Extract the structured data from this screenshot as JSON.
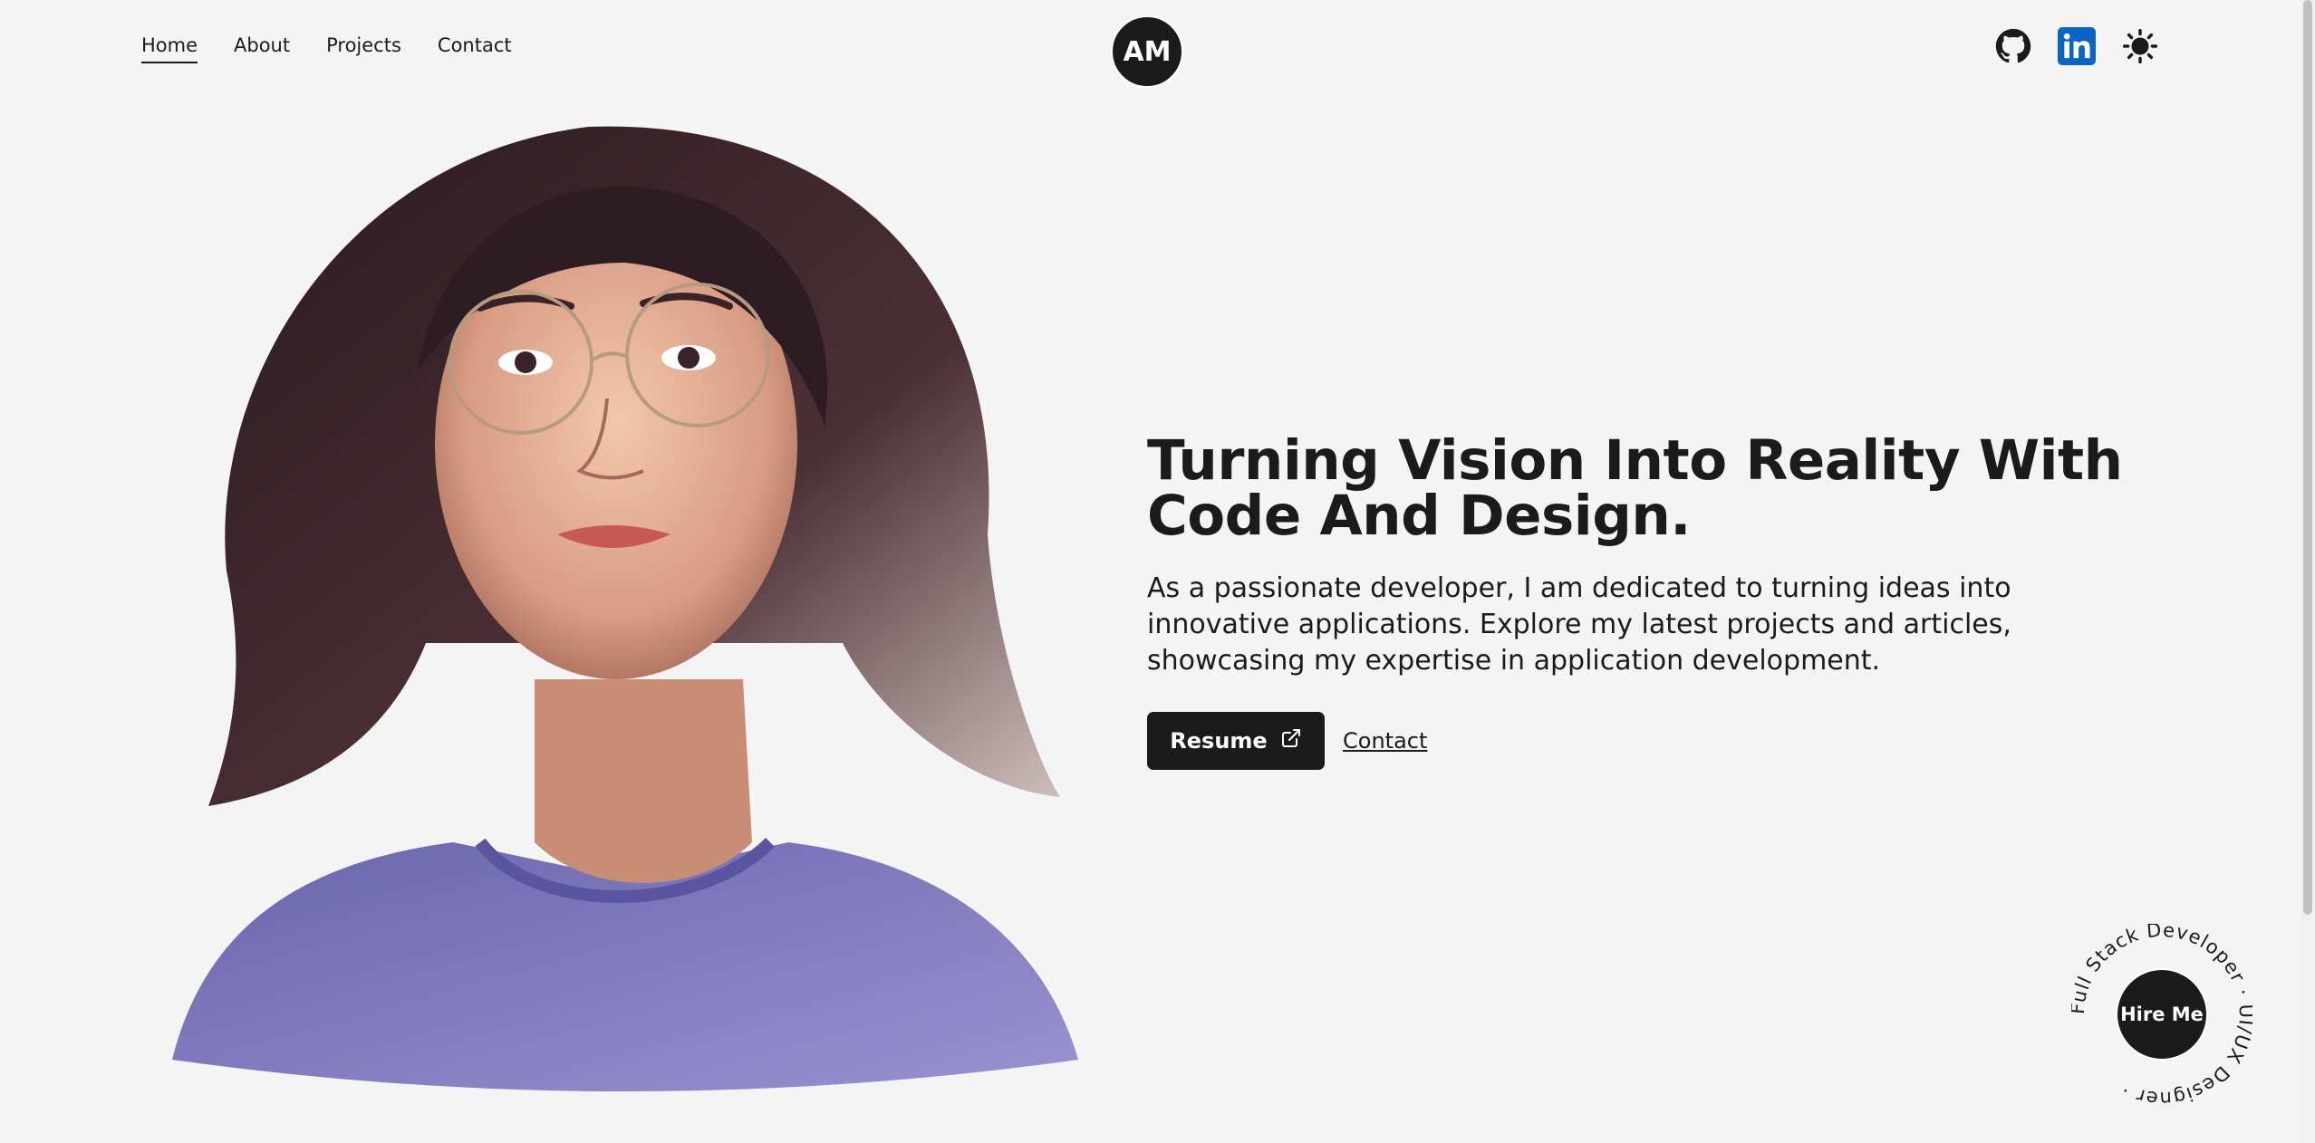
{
  "nav": {
    "items": [
      {
        "label": "Home",
        "active": true
      },
      {
        "label": "About"
      },
      {
        "label": "Projects"
      },
      {
        "label": "Contact"
      }
    ]
  },
  "logo": {
    "text": "AM"
  },
  "social": {
    "icons": [
      "github-icon",
      "linkedin-icon",
      "sun-icon"
    ]
  },
  "hero": {
    "title": "Turning Vision Into Reality With Code And Design.",
    "description": "As a passionate developer, I am dedicated to turning ideas into innovative applications. Explore my latest projects and articles, showcasing my expertise in application development.",
    "resume_label": "Resume",
    "contact_label": "Contact"
  },
  "hire": {
    "button_label": "Hire Me",
    "ring_text": "Full Stack Developer · UI/UX Designer · "
  },
  "colors": {
    "background": "#f4f4f4",
    "primary": "#1b1b1b",
    "linkedin": "#0a66c2"
  }
}
